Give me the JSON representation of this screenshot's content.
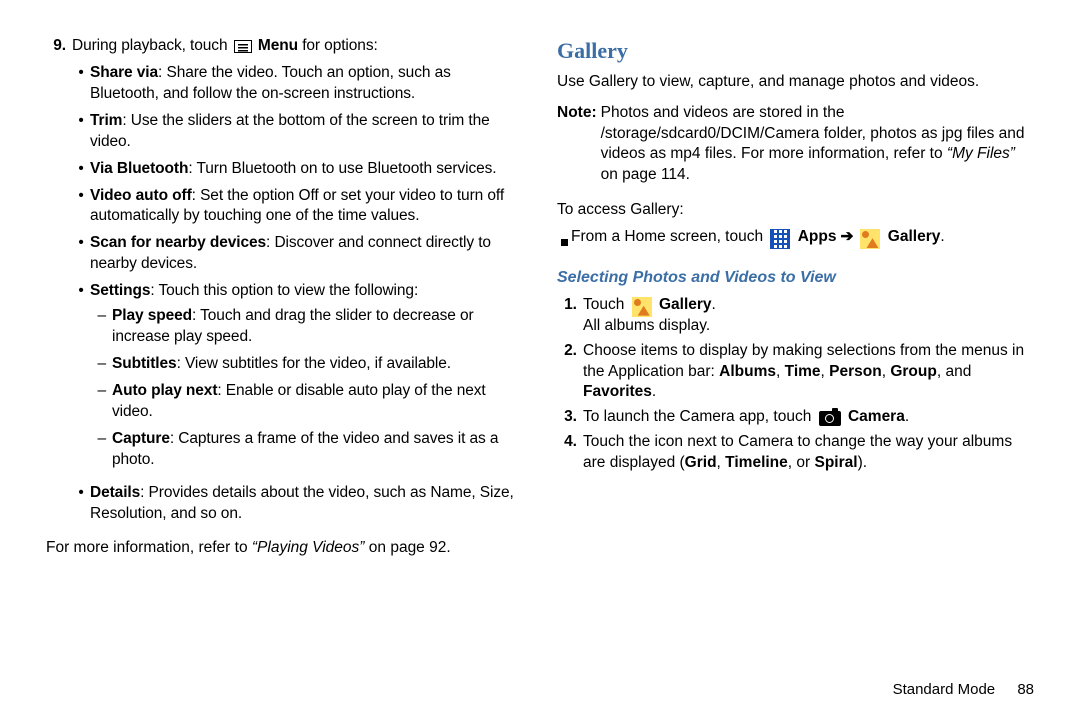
{
  "left": {
    "step_num": "9.",
    "step_text_pre": "During playback, touch ",
    "step_text_bold": "Menu",
    "step_text_post": " for options:",
    "bullets": [
      {
        "term": "Share via",
        "text": ": Share the video. Touch an option, such as Bluetooth, and follow the on-screen instructions."
      },
      {
        "term": "Trim",
        "text": ": Use the sliders at the bottom of the screen to trim the video."
      },
      {
        "term": "Via Bluetooth",
        "text": ": Turn Bluetooth on to use Bluetooth services."
      },
      {
        "term": "Video auto off",
        "text": ": Set the option Off or set your video to turn off automatically by touching one of the time values."
      },
      {
        "term": "Scan for nearby devices",
        "text": ": Discover and connect directly to nearby devices."
      },
      {
        "term": "Settings",
        "text": ": Touch this option to view the following:"
      }
    ],
    "dashes": [
      {
        "term": "Play speed",
        "text": ": Touch and drag the slider to decrease or increase play speed."
      },
      {
        "term": "Subtitles",
        "text": ": View subtitles for the video, if available."
      },
      {
        "term": "Auto play next",
        "text": ": Enable or disable auto play of the next video."
      },
      {
        "term": "Capture",
        "text": ": Captures a frame of the video and saves it as a photo."
      }
    ],
    "details": {
      "term": "Details",
      "text": ": Provides details about the video, such as Name, Size, Resolution, and so on."
    },
    "more_pre": "For more information, refer to ",
    "more_italic": "“Playing Videos”",
    "more_post": " on page 92."
  },
  "right": {
    "heading": "Gallery",
    "intro": "Use Gallery to view, capture, and manage photos and videos.",
    "note_label": "Note:",
    "note_body_pre": "Photos and videos are stored in the /storage/sdcard0/DCIM/Camera folder, photos as jpg files and videos as mp4 files. For more information, refer to ",
    "note_body_italic": "“My Files”",
    "note_body_post": " on page 114.",
    "access": "To access Gallery:",
    "from_pre": "From a Home screen, touch ",
    "apps_label": "Apps",
    "arrow": "➔",
    "gallery_label": "Gallery",
    "subheading": "Selecting Photos and Videos to View",
    "steps": {
      "s1_num": "1.",
      "s1_pre": "Touch ",
      "s1_bold": "Gallery",
      "s1_post": ".",
      "s1_line2": "All albums display.",
      "s2_num": "2.",
      "s2_pre": "Choose items to display by making selections from the menus in the Application bar: ",
      "s2_b1": "Albums",
      "s2_c1": ", ",
      "s2_b2": "Time",
      "s2_c2": ", ",
      "s2_b3": "Person",
      "s2_c3": ", ",
      "s2_b4": "Group",
      "s2_c4": ", and ",
      "s2_b5": "Favorites",
      "s2_post": ".",
      "s3_num": "3.",
      "s3_pre": "To launch the Camera app, touch ",
      "s3_bold": "Camera",
      "s3_post": ".",
      "s4_num": "4.",
      "s4_pre": "Touch the icon next to Camera to change the way your albums are displayed (",
      "s4_b1": "Grid",
      "s4_c1": ", ",
      "s4_b2": "Timeline",
      "s4_c2": ", or ",
      "s4_b3": "Spiral",
      "s4_post": ")."
    }
  },
  "footer": {
    "mode": "Standard Mode",
    "page": "88"
  }
}
